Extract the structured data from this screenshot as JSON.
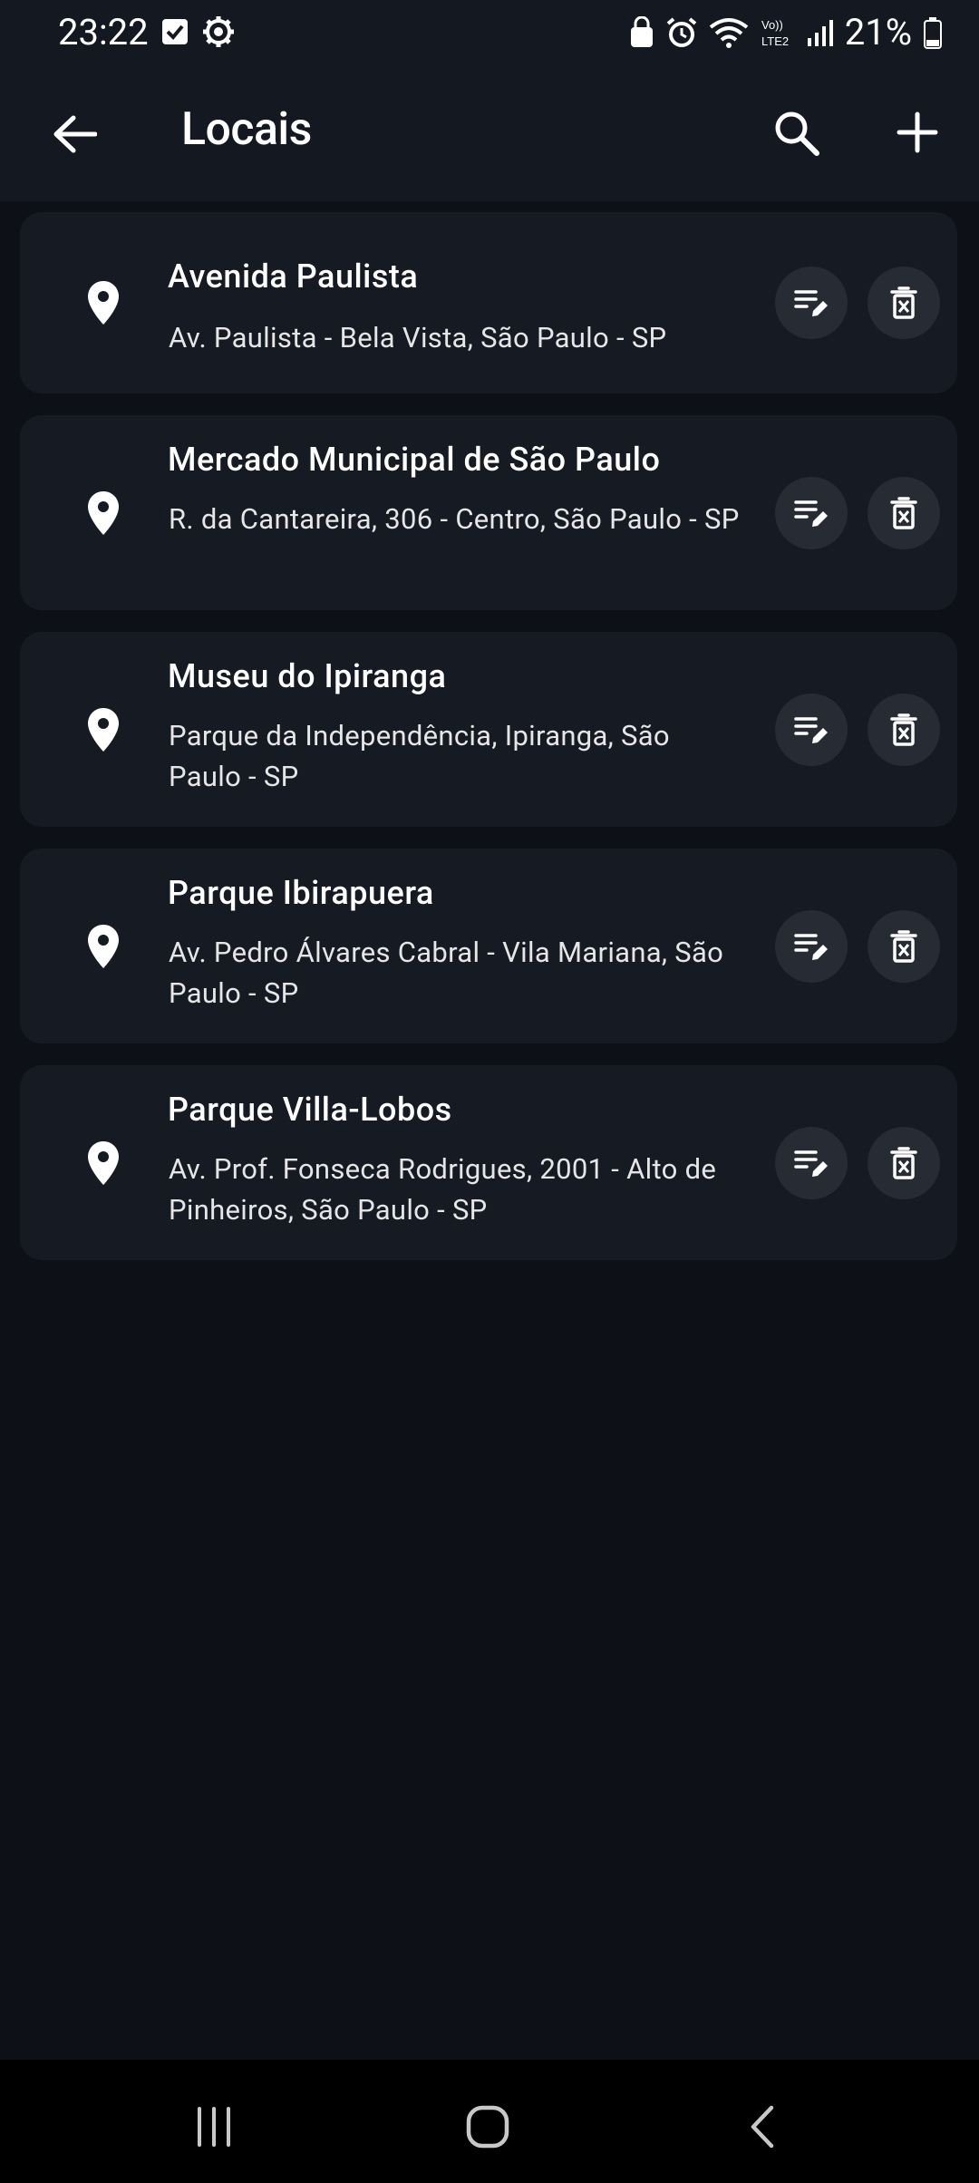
{
  "status_bar": {
    "time": "23:22",
    "battery": "21%",
    "left_icons": [
      "checkbox-notification-icon",
      "settings-notification-icon"
    ],
    "right_icons": [
      "lock-notification-icon",
      "alarm-icon",
      "wifi-icon",
      "volte-lte2-icon",
      "signal-icon",
      "battery-icon"
    ]
  },
  "app_bar": {
    "title": "Locais",
    "icons": {
      "back": "arrow-back-icon",
      "search": "search-icon",
      "add": "add-icon"
    }
  },
  "locations": [
    {
      "name": "Avenida Paulista",
      "address": "Av. Paulista - Bela Vista, São Paulo - SP"
    },
    {
      "name": "Mercado Municipal de São Paulo",
      "address": "R. da Cantareira, 306 - Centro, São Paulo - SP"
    },
    {
      "name": "Museu do Ipiranga",
      "address": "Parque da Independência, Ipiranga, São Paulo - SP"
    },
    {
      "name": "Parque Ibirapuera",
      "address": "Av. Pedro Álvares Cabral - Vila Mariana, São Paulo - SP"
    },
    {
      "name": "Parque Villa-Lobos",
      "address": "Av. Prof. Fonseca Rodrigues, 2001 - Alto de Pinheiros, São Paulo - SP"
    }
  ],
  "card_icons": {
    "location": "location-pin-icon",
    "edit": "edit-note-icon",
    "delete": "delete-icon"
  },
  "nav_bar": {
    "icons": [
      "recent-apps-icon",
      "home-icon",
      "back-icon"
    ]
  },
  "colors": {
    "background": "#0d1017",
    "app_bar": "#141820",
    "card": "#161a22",
    "button": "#272b33",
    "text": "#ffffff"
  }
}
